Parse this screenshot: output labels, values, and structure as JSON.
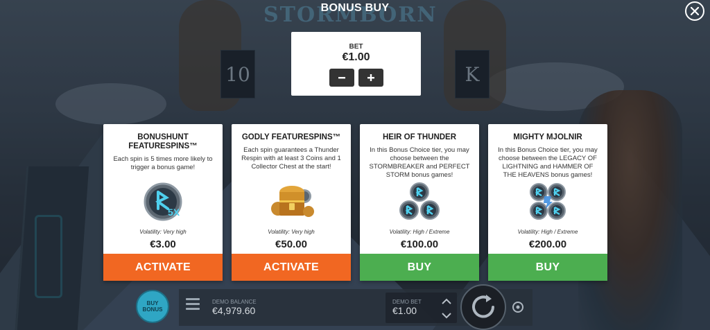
{
  "header": {
    "title": "BONUS BUY",
    "game_logo": "STORMBORN"
  },
  "background": {
    "reel_symbols": [
      "10",
      "K"
    ]
  },
  "bet": {
    "label": "BET",
    "value": "€1.00",
    "minus_icon": "minus-icon",
    "plus_icon": "plus-icon"
  },
  "cards": [
    {
      "title": "BONUSHUNT FEATURESPINS™",
      "description": "Each spin is 5 times more likely to trigger a bonus game!",
      "icon": "rune-5x-icon",
      "volatility": "Volatility: Very high",
      "price": "€3.00",
      "button": "ACTIVATE",
      "button_color": "#f16722"
    },
    {
      "title": "GODLY FEATURESPINS™",
      "description": "Each spin guarantees a Thunder Respin with at least 3 Coins and 1 Collector Chest at the start!",
      "icon": "treasure-chest-icon",
      "volatility": "Volatility: Very high",
      "price": "€50.00",
      "button": "ACTIVATE",
      "button_color": "#f16722"
    },
    {
      "title": "HEIR OF THUNDER",
      "description": "In this Bonus Choice tier, you may choose between the STORMBREAKER and PERFECT STORM bonus games!",
      "icon": "three-runes-icon",
      "volatility": "Volatility: High / Extreme",
      "price": "€100.00",
      "button": "BUY",
      "button_color": "#4cae50"
    },
    {
      "title": "MIGHTY MJOLNIR",
      "description": "In this Bonus Choice tier, you may choose between the LEGACY OF LIGHTNING and HAMMER OF THE HEAVENS bonus games!",
      "icon": "four-runes-icon",
      "volatility": "Volatility: High / Extreme",
      "price": "€200.00",
      "button": "BUY",
      "button_color": "#4cae50"
    }
  ],
  "bottom_bar": {
    "buy_bonus_label": "BUY BONUS",
    "demo_balance_label": "DEMO BALANCE",
    "demo_balance_value": "€4,979.60",
    "demo_bet_label": "DEMO BET",
    "demo_bet_value": "€1.00"
  },
  "colors": {
    "activate": "#f16722",
    "buy": "#4cae50",
    "rune": "#36b4d4"
  }
}
